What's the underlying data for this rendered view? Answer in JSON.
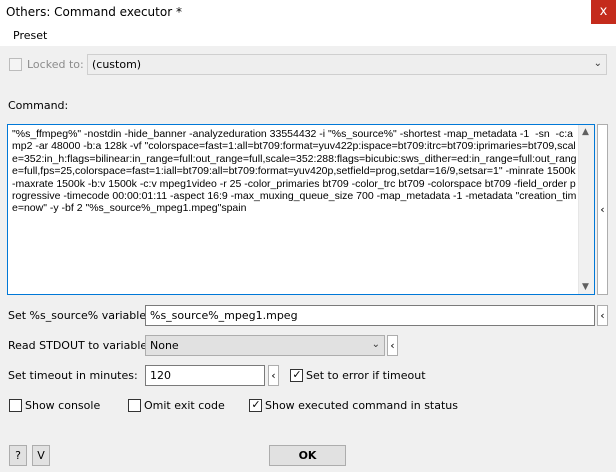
{
  "window": {
    "title": "Others: Command executor *",
    "close_glyph": "x"
  },
  "menu": {
    "preset": "Preset"
  },
  "locked": {
    "label": "Locked to:",
    "checked": false,
    "selected": "(custom)"
  },
  "command": {
    "label": "Command:",
    "value": "\"%s_ffmpeg%\" -nostdin -hide_banner -analyzeduration 33554432 -i \"%s_source%\" -shortest -map_metadata -1  -sn  -c:a mp2 -ar 48000 -b:a 128k -vf \"colorspace=fast=1:all=bt709:format=yuv422p:ispace=bt709:itrc=bt709:iprimaries=bt709,scale=352:in_h:flags=bilinear:in_range=full:out_range=full,scale=352:288:flags=bicubic:sws_dither=ed:in_range=full:out_range=full,fps=25,colorspace=fast=1:iall=bt709:all=bt709:format=yuv420p,setfield=prog,setdar=16/9,setsar=1\" -minrate 1500k -maxrate 1500k -b:v 1500k -c:v mpeg1video -r 25 -color_primaries bt709 -color_trc bt709 -colorspace bt709 -field_order progressive -timecode 00:00:01:11 -aspect 16:9 -max_muxing_queue_size 700 -map_metadata -1 -metadata \"creation_time=now\" -y -bf 2 \"%s_source%_mpeg1.mpeg\"spain"
  },
  "source_var": {
    "label": "Set %s_source% variable to:",
    "value": "%s_source%_mpeg1.mpeg"
  },
  "stdout": {
    "label": "Read STDOUT to variable:",
    "selected": "None"
  },
  "timeout": {
    "label": "Set timeout in minutes:",
    "value": "120",
    "error_label": "Set to error if timeout",
    "error_checked": true
  },
  "options": {
    "show_console": {
      "label": "Show console",
      "checked": false
    },
    "omit_exit": {
      "label": "Omit exit code",
      "checked": false
    },
    "show_executed": {
      "label": "Show executed command in status",
      "checked": true
    }
  },
  "buttons": {
    "help": "?",
    "v": "V",
    "ok": "OK"
  },
  "glyphs": {
    "expand": "‹",
    "dropdown": "⌄",
    "check": "✓",
    "scroll_up": "▲",
    "scroll_down": "▼"
  }
}
